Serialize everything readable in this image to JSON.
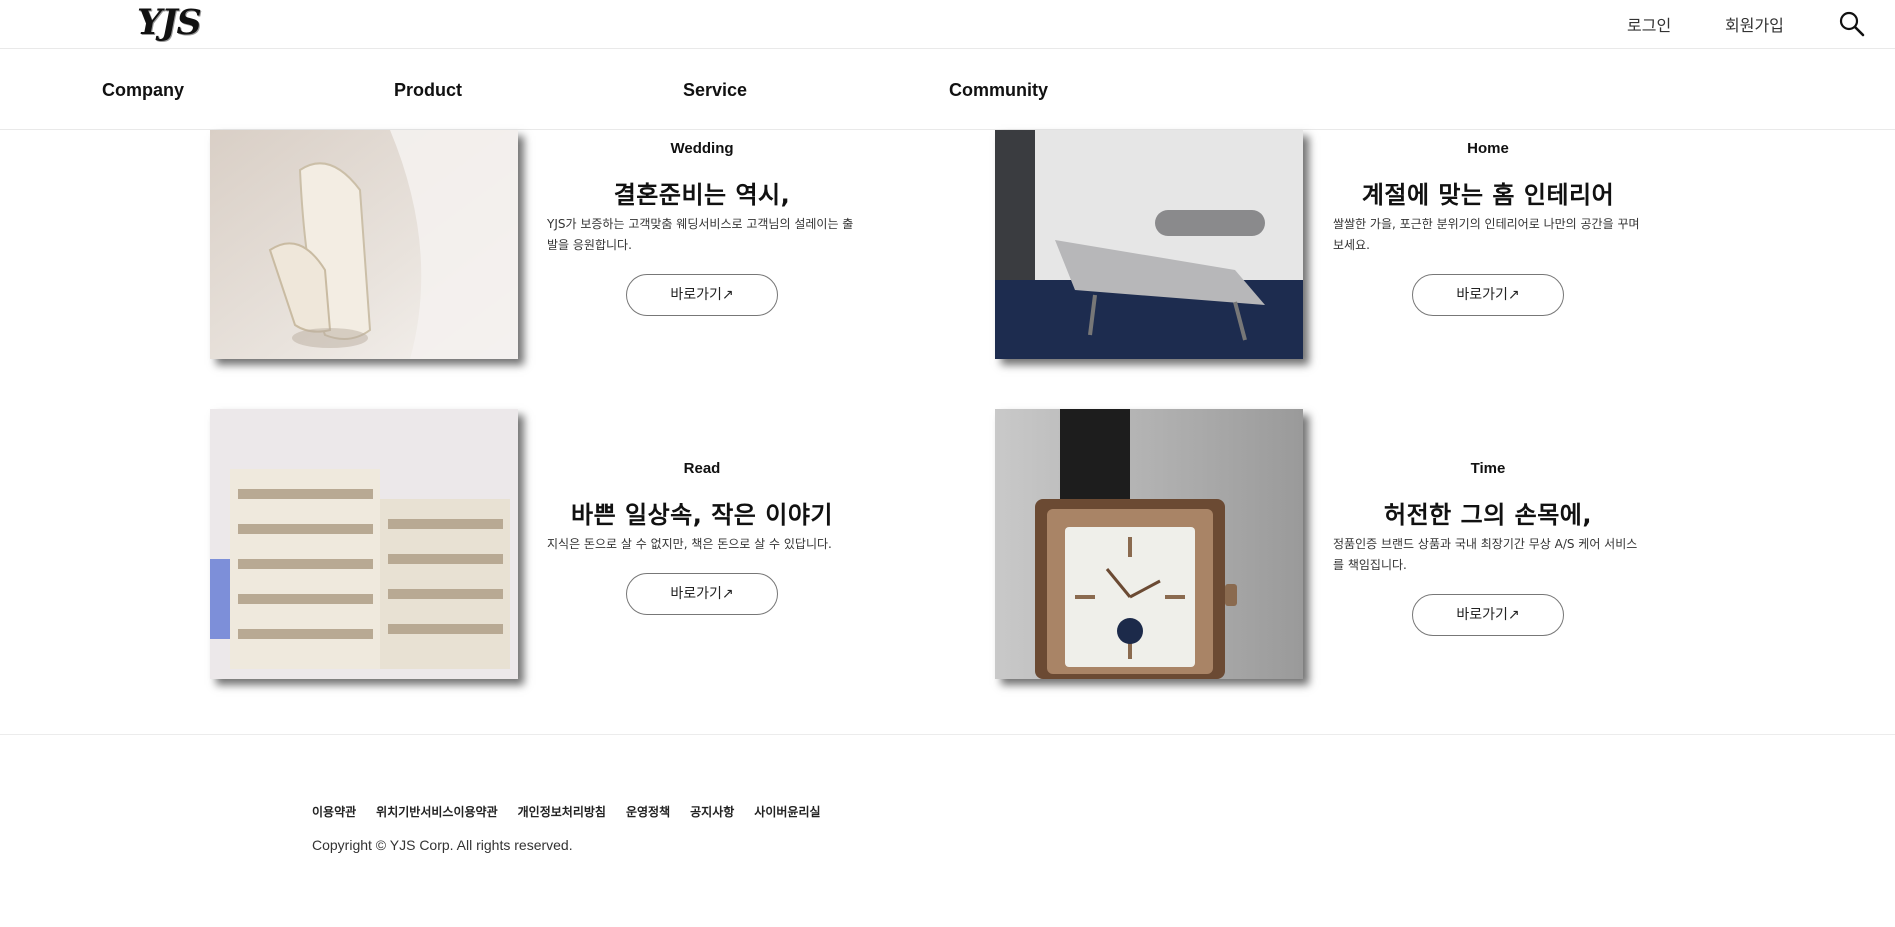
{
  "header": {
    "logo": "YJS",
    "login_label": "로그인",
    "signup_label": "회원가입",
    "search_icon": "search-icon"
  },
  "nav": {
    "items": [
      "Company",
      "Product",
      "Service",
      "Community"
    ]
  },
  "cards": [
    {
      "category": "Wedding",
      "title": "결혼준비는 역시,",
      "description": "YJS가 보증하는 고객맞춤 웨딩서비스로 고객님의 설레이는 출발을 응원합니다.",
      "button": "바로가기↗",
      "image": "wedding-shoes-image"
    },
    {
      "category": "Home",
      "title": "계절에 맞는 홈 인테리어",
      "description": "쌀쌀한 가을, 포근한 분위기의 인테리어로 나만의 공간을 꾸며보세요.",
      "button": "바로가기↗",
      "image": "chaise-lounge-image"
    },
    {
      "category": "Read",
      "title": "바쁜 일상속, 작은 이야기",
      "description": "지식은 돈으로 살 수 없지만, 책은 돈으로 살 수 있답니다.",
      "button": "바로가기↗",
      "image": "bookshelf-image"
    },
    {
      "category": "Time",
      "title": "허전한 그의 손목에,",
      "description": "정품인증 브랜드 상품과 국내 최장기간 무상 A/S 케어 서비스를 책임집니다.",
      "button": "바로가기↗",
      "image": "wristwatch-image"
    }
  ],
  "footer": {
    "links": [
      "이용약관",
      "위치기반서비스이용약관",
      "개인정보처리방침",
      "운영정책",
      "공지사항",
      "사이버윤리실"
    ],
    "copyright": "Copyright © YJS Corp. All rights reserved."
  }
}
